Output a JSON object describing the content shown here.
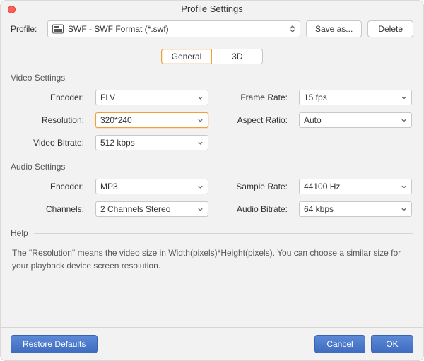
{
  "title": "Profile Settings",
  "profile": {
    "label": "Profile:",
    "selected": "SWF - SWF Format (*.swf)",
    "save_as_label": "Save as...",
    "delete_label": "Delete"
  },
  "tabs": {
    "general": "General",
    "three_d": "3D"
  },
  "video": {
    "group_title": "Video Settings",
    "encoder_label": "Encoder:",
    "encoder_value": "FLV",
    "framerate_label": "Frame Rate:",
    "framerate_value": "15 fps",
    "resolution_label": "Resolution:",
    "resolution_value": "320*240",
    "aspect_label": "Aspect Ratio:",
    "aspect_value": "Auto",
    "bitrate_label": "Video Bitrate:",
    "bitrate_value": "512 kbps"
  },
  "audio": {
    "group_title": "Audio Settings",
    "encoder_label": "Encoder:",
    "encoder_value": "MP3",
    "samplerate_label": "Sample Rate:",
    "samplerate_value": "44100 Hz",
    "channels_label": "Channels:",
    "channels_value": "2 Channels Stereo",
    "bitrate_label": "Audio Bitrate:",
    "bitrate_value": "64 kbps"
  },
  "help": {
    "group_title": "Help",
    "body": "The \"Resolution\" means the video size in Width(pixels)*Height(pixels).  You can choose a similar size for your playback device screen resolution."
  },
  "footer": {
    "restore": "Restore Defaults",
    "cancel": "Cancel",
    "ok": "OK"
  }
}
